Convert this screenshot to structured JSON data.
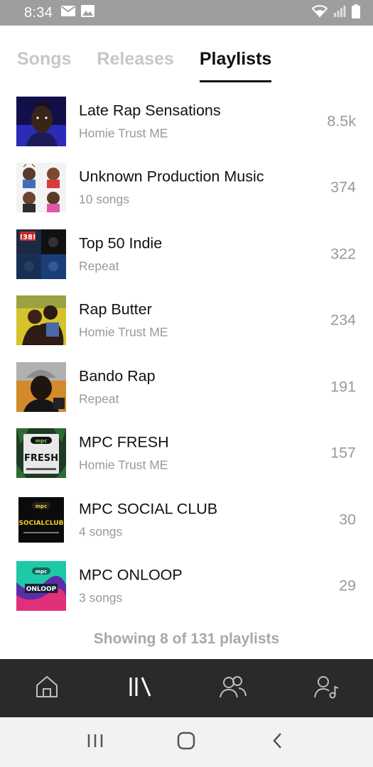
{
  "status_bar": {
    "time": "8:34",
    "icons_left": [
      "mail-icon",
      "image-icon"
    ],
    "icons_right": [
      "wifi-icon",
      "signal-icon",
      "battery-icon"
    ]
  },
  "tabs": [
    {
      "label": "Songs",
      "active": false
    },
    {
      "label": "Releases",
      "active": false
    },
    {
      "label": "Playlists",
      "active": true
    }
  ],
  "playlists": [
    {
      "title": "Late Rap Sensations",
      "subtitle": "Homie Trust ME",
      "count": "8.5k"
    },
    {
      "title": "Unknown Production Music",
      "subtitle": "10 songs",
      "count": "374"
    },
    {
      "title": "Top 50 Indie",
      "subtitle": "Repeat",
      "count": "322"
    },
    {
      "title": "Rap Butter",
      "subtitle": "Homie Trust ME",
      "count": "234"
    },
    {
      "title": "Bando Rap",
      "subtitle": "Repeat",
      "count": "191"
    },
    {
      "title": "MPC FRESH",
      "subtitle": "Homie Trust ME",
      "count": "157"
    },
    {
      "title": "MPC SOCIAL CLUB",
      "subtitle": "4 songs",
      "count": "30"
    },
    {
      "title": "MPC ONLOOP",
      "subtitle": "3 songs",
      "count": "29"
    }
  ],
  "art_labels": {
    "fresh": "FRESH",
    "socialclub": "SOCIALCLUB",
    "onloop": "ONLOOP",
    "mpc": "mpc",
    "top50": "!38!"
  },
  "footer": {
    "showing": "Showing 8 of 131 playlists"
  },
  "bottom_nav": [
    "home-icon",
    "library-icon",
    "audience-icon",
    "artist-icon"
  ],
  "system_nav": [
    "recent-apps-icon",
    "home-button-icon",
    "back-icon"
  ],
  "colors": {
    "status_bar": "#9e9e9e",
    "bottom_nav": "#2a2a2a",
    "tab_inactive": "#c7c7c7",
    "secondary_text": "#999999"
  }
}
